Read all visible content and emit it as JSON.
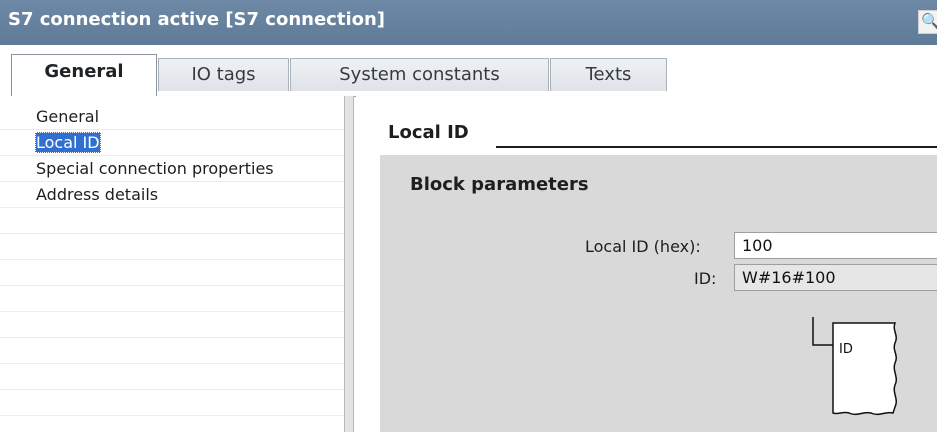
{
  "window": {
    "title": "S7 connection active [S7 connection]",
    "properties_button_glyph": "P"
  },
  "tabs": [
    {
      "label": "General",
      "active": true
    },
    {
      "label": "IO tags",
      "active": false
    },
    {
      "label": "System constants",
      "active": false
    },
    {
      "label": "Texts",
      "active": false
    }
  ],
  "nav": {
    "items": [
      {
        "label": "General",
        "selected": false
      },
      {
        "label": "Local ID",
        "selected": true
      },
      {
        "label": "Special connection properties",
        "selected": false
      },
      {
        "label": "Address details",
        "selected": false
      }
    ]
  },
  "section": {
    "title": "Local ID",
    "panel_title": "Block parameters",
    "local_id_label": "Local ID (hex):",
    "local_id_value": "100",
    "id_label": "ID:",
    "id_value": "W#16#100",
    "block_pin_label": "ID"
  },
  "colors": {
    "titlebar": "#6e89a5",
    "selection": "#2f6fd1",
    "panel": "#d9d9d9"
  }
}
